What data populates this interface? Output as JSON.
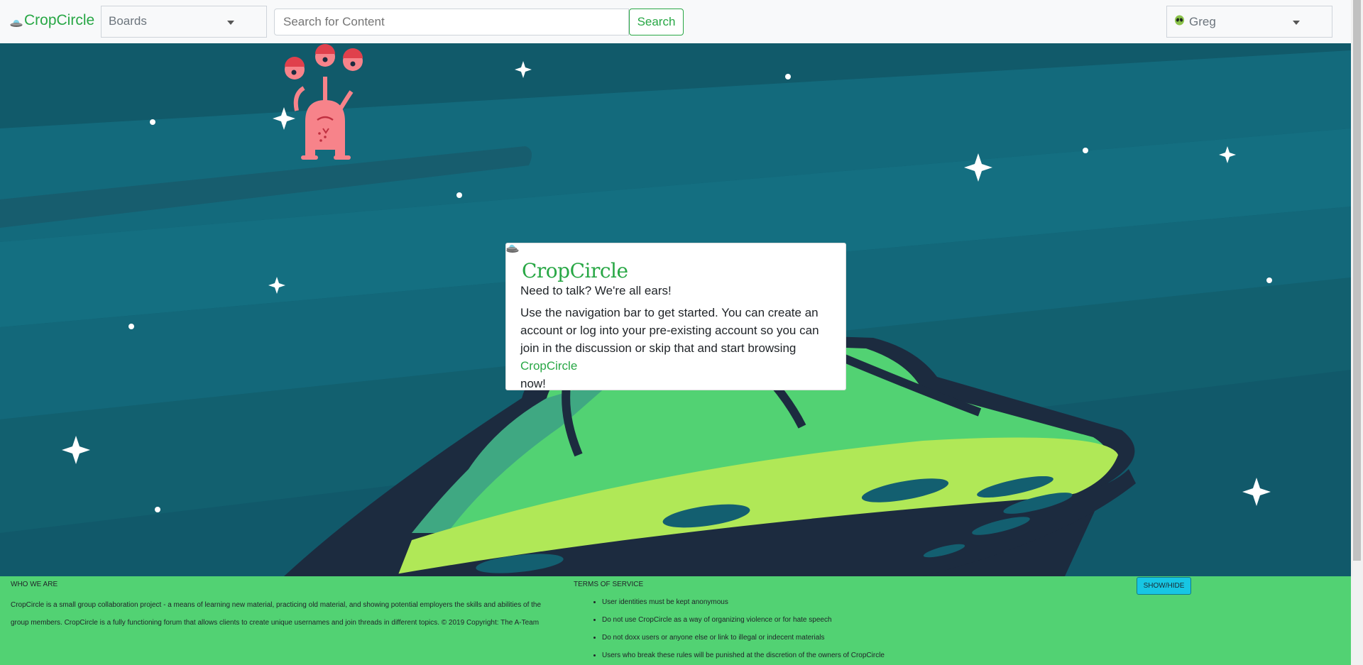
{
  "navbar": {
    "brand": "CropCircle",
    "boards_select": "Boards",
    "search_placeholder": "Search for Content",
    "search_button": "Search",
    "user_select": "Greg"
  },
  "card": {
    "title": "CropCircle",
    "subtitle": "Need to talk? We're all ears!",
    "body": "Use the navigation bar to get started. You can create an account or log into your pre-existing account so you can join in the discussion or skip that and start browsing",
    "link": "CropCircle",
    "tail": "now!"
  },
  "footer": {
    "who_heading": "WHO WE ARE",
    "who_text": "CropCircle is a small group collaboration project - a means of learning new material, practicing old material, and showing potential employers the skills and abilities of the group members. CropCircle is a fully functioning forum that allows clients to create unique usernames and join threads in different topics. © 2019 Copyright: The A-Team",
    "terms_heading": "TERMS OF SERVICE",
    "terms": [
      "User identities must be kept anonymous",
      "Do not use CropCircle as a way of organizing violence or for hate speech",
      "Do not doxx users or anyone else or link to illegal or indecent materials",
      "Users who break these rules will be punished at the discretion of the owners of CropCircle"
    ],
    "toggle_button": "SHOW/HIDE"
  },
  "icons": {
    "brand": "ufo-icon",
    "user": "alien-face-icon",
    "mascot": "three-eyed-alien-icon"
  },
  "colors": {
    "brand_green": "#28a745",
    "hero_teal": "#135f70",
    "footer_green": "#52d273",
    "ufo_green": "#52d273",
    "ufo_lime": "#b0e857",
    "ufo_dark": "#1c2b3f",
    "alien_pink": "#f7838a",
    "button_cyan": "#17c6e3"
  }
}
